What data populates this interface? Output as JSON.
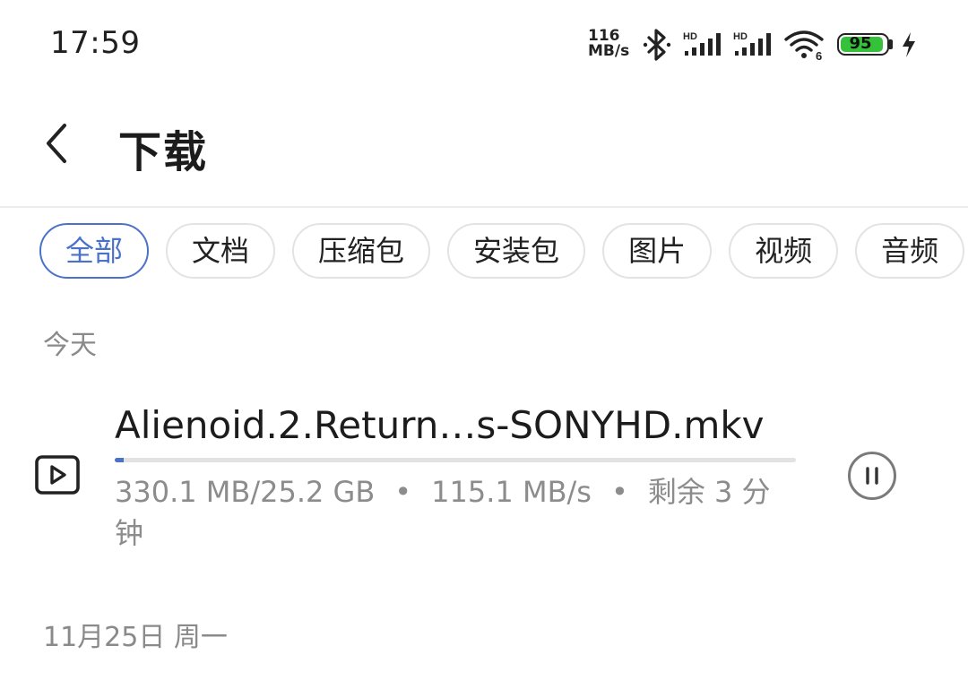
{
  "status_bar": {
    "time": "17:59",
    "net_speed_value": "116",
    "net_speed_unit": "MB/s",
    "signal_label_1": "HD",
    "signal_label_2": "HD",
    "wifi_label": "6",
    "battery_level": "95",
    "battery_fraction": 0.95,
    "battery_color": "#35c23a",
    "icons": [
      "bluetooth-icon",
      "signal-icon",
      "signal-icon",
      "wifi-icon",
      "battery-icon",
      "charging-icon"
    ]
  },
  "header": {
    "back_icon": "chevron-left-icon",
    "title": "下载"
  },
  "filters": {
    "active_index": 0,
    "accent_color": "#4a72c9",
    "items": [
      "全部",
      "文档",
      "压缩包",
      "安装包",
      "图片",
      "视频",
      "音频"
    ]
  },
  "sections": {
    "today": "今天",
    "date_group": "11月25日 周一"
  },
  "downloads": [
    {
      "icon": "video-file-icon",
      "name": "Alienoid.2.Return…s-SONYHD.mkv",
      "size_progress": "330.1 MB/25.2 GB",
      "speed": "115.1 MB/s",
      "remaining": "剩余 3 分钟",
      "progress": 0.013,
      "action_icon": "pause-icon"
    }
  ]
}
